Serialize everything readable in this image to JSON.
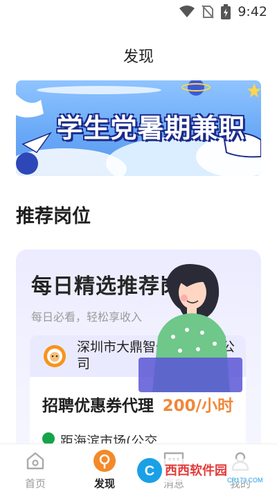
{
  "status_bar": {
    "time": "9:42",
    "icons": [
      "wifi-icon",
      "no-sim-icon",
      "battery-charging-icon"
    ]
  },
  "header": {
    "title": "发现"
  },
  "banner": {
    "text": "学生党暑期兼职"
  },
  "section": {
    "title": "推荐岗位"
  },
  "card": {
    "title": "每日精选推荐岗位",
    "subtitle": "每日必看，轻松享收入",
    "job": {
      "company": "深圳市大鼎智付科技有限公司",
      "title": "招聘优惠券代理",
      "salary": "200/小时",
      "location": "距海滨市场(公交"
    }
  },
  "bottom_nav": {
    "items": [
      {
        "label": "首页",
        "icon": "home-icon"
      },
      {
        "label": "发现",
        "icon": "discover-icon"
      },
      {
        "label": "消息",
        "icon": "message-icon"
      },
      {
        "label": "我的",
        "icon": "profile-icon"
      }
    ]
  },
  "watermark": {
    "brand": "西西软件园",
    "url": "CR173.COM"
  },
  "colors": {
    "accent": "#f0883a",
    "banner_blue": "#6aa9f7",
    "card_bg": "#ecebff",
    "discover_icon": "#f38a2a"
  }
}
